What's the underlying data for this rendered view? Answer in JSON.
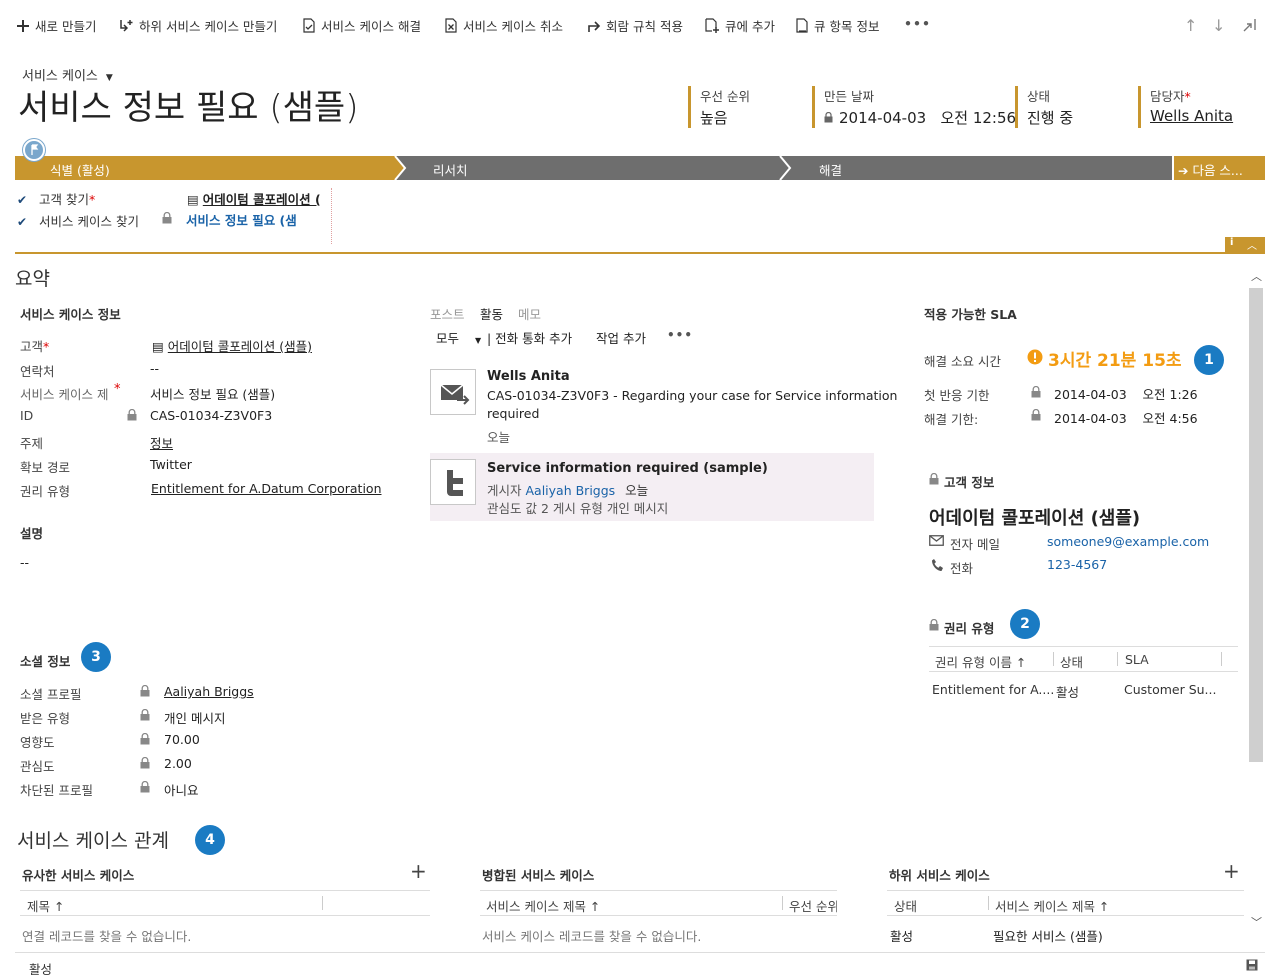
{
  "toolbar": {
    "new": "새로 만들기",
    "create_child": "하위 서비스 케이스 만들기",
    "resolve": "서비스 케이스 해결",
    "cancel": "서비스 케이스 취소",
    "apply_routing": "회람 규칙 적용",
    "add_to_queue": "큐에 추가",
    "queue_item_details": "큐 항목 정보",
    "more": "•••"
  },
  "header": {
    "entity": "서비스 케이스",
    "title": "서비스 정보 필요 (샘플)",
    "fields": [
      {
        "label": "우선 순위",
        "value": "높음"
      },
      {
        "label": "만든 날짜",
        "value": "2014-04-03   오전 12:56"
      },
      {
        "label": "상태",
        "value": "진행 중"
      },
      {
        "label": "담당자",
        "value": "Wells Anita"
      }
    ]
  },
  "process": {
    "stages": [
      "식별 (활성)",
      "리서치",
      "해결"
    ],
    "next_stage": "다음 스...",
    "steps": [
      {
        "label": "고객 찾기",
        "value": "어데이텀 콜포레이션 ("
      },
      {
        "label": "서비스 케이스 찾기",
        "value": "서비스 정보 필요 (샘"
      }
    ]
  },
  "summary": {
    "title": "요약",
    "case_info": {
      "title": "서비스 케이스 정보",
      "fields": [
        {
          "label": "고객",
          "value": "어데이텀 콜포레이션 (샘플)"
        },
        {
          "label": "연락처",
          "value": "--"
        },
        {
          "label": "서비스 케이스 제",
          "value": "서비스 정보 필요 (샘플)"
        },
        {
          "label": "ID",
          "value": "CAS-01034-Z3V0F3"
        },
        {
          "label": "주제",
          "value": "정보"
        },
        {
          "label": "확보 경로",
          "value": "Twitter"
        },
        {
          "label": "권리 유형",
          "value": "Entitlement for A.Datum Corporation"
        }
      ]
    },
    "description": {
      "label": "설명",
      "value": "--"
    },
    "social": {
      "title": "소셜 정보",
      "badge": "3",
      "fields": [
        {
          "label": "소셜 프로필",
          "value": "Aaliyah Briggs"
        },
        {
          "label": "받은 유형",
          "value": "개인 메시지"
        },
        {
          "label": "영향도",
          "value": "70.00"
        },
        {
          "label": "관심도",
          "value": "2.00"
        },
        {
          "label": "차단된 프로필",
          "value": "아니요"
        }
      ]
    }
  },
  "activity": {
    "tabs": [
      "포스트",
      "활동",
      "메모"
    ],
    "filter": "모두",
    "add_phone_call": "| 전화 통화 추가",
    "add_task": "작업 추가",
    "more": "•••",
    "items": [
      {
        "title": "Wells Anita",
        "line1": "CAS-01034-Z3V0F3 - Regarding your case for Service information",
        "line2": "required",
        "meta": "오늘"
      },
      {
        "title": "Service information required (sample)",
        "poster_prefix": "게시자",
        "poster": "Aaliyah Briggs",
        "date": "오늘",
        "line3": "관심도 값 2 게시 유형 개인 메시지"
      }
    ]
  },
  "sla": {
    "title": "적용 가능한 SLA",
    "badge": "1",
    "resolve_time_label": "해결 소요 시간",
    "resolve_time_value": "3시간 21분 15초",
    "first_response_label": "첫 반응 기한",
    "first_response_value": "2014-04-03    오전 1:26",
    "resolve_by_label": "해결 기한:",
    "resolve_by_value": "2014-04-03    오전 4:56"
  },
  "customer": {
    "title": "고객 정보",
    "name": "어데이텀 콜포레이션 (샘플)",
    "email_label": "전자 메일",
    "email": "someone9@example.com",
    "phone_label": "전화",
    "phone": "123-4567"
  },
  "entitlements": {
    "title": "권리 유형",
    "badge": "2",
    "columns": [
      "권리 유형 이름 ↑",
      "상태",
      "SLA"
    ],
    "rows": [
      [
        "Entitlement for A....",
        "활성",
        "Customer Su..."
      ]
    ]
  },
  "relations": {
    "title": "서비스 케이스 관계",
    "badge": "4",
    "similar": {
      "title": "유사한 서비스 케이스",
      "columns": [
        "제목 ↑"
      ],
      "empty": "연결 레코드를 찾을 수 없습니다."
    },
    "merged": {
      "title": "병합된 서비스 케이스",
      "columns": [
        "서비스 케이스 제목 ↑",
        "우선 순위"
      ],
      "empty": "서비스 케이스 레코드를 찾을 수 없습니다."
    },
    "child": {
      "title": "하위 서비스 케이스",
      "columns": [
        "상태",
        "서비스 케이스 제목 ↑"
      ],
      "row": [
        "활성",
        "필요한 서비스 (샘플)"
      ]
    }
  },
  "footer": {
    "status": "활성"
  },
  "colors": {
    "accent": "#c8962e",
    "stage_inactive": "#6e6e6e",
    "badge": "#1a7bc3",
    "sla_warning": "#f39c12"
  }
}
